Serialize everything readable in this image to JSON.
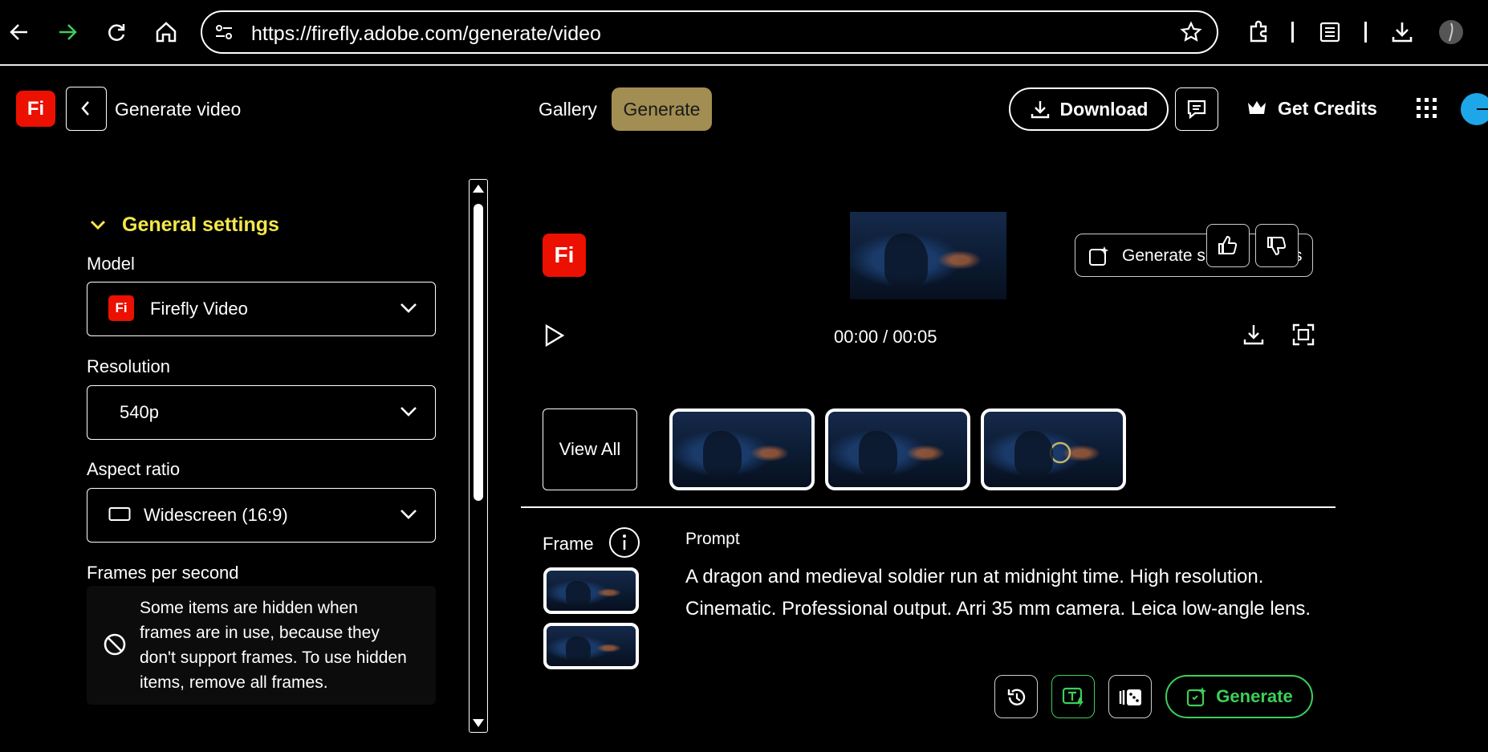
{
  "browser": {
    "url": "https://firefly.adobe.com/generate/video"
  },
  "header": {
    "logo_text": "Fi",
    "page_title": "Generate video",
    "nav_gallery": "Gallery",
    "nav_generate": "Generate",
    "download_label": "Download",
    "credits_label": "Get Credits"
  },
  "settings": {
    "section_title": "General settings",
    "model_label": "Model",
    "model_value": "Firefly Video",
    "resolution_label": "Resolution",
    "resolution_value": "540p",
    "aspect_label": "Aspect ratio",
    "aspect_value": "Widescreen (16:9)",
    "fps_label": "Frames per second",
    "hidden_note": "Some items are hidden when frames are in use, because they don't support frames. To use hidden items, remove all frames."
  },
  "video": {
    "logo_text": "Fi",
    "generate_similar_label": "Generate si",
    "generate_similar_tail": "s",
    "time": "00:00 / 00:05",
    "view_all": "View All"
  },
  "prompt": {
    "frame_label": "Frame",
    "prompt_label": "Prompt",
    "text": "A dragon and medieval soldier run at midnight time. High resolution. Cinematic. Professional output. Arri 35 mm camera. Leica low-angle lens.",
    "generate_label": "Generate"
  },
  "colors": {
    "accent_yellow": "#f3e84a",
    "generate_tab": "#a28e52",
    "adobe_red": "#eb1000",
    "generate_green": "#3ccf5a"
  }
}
